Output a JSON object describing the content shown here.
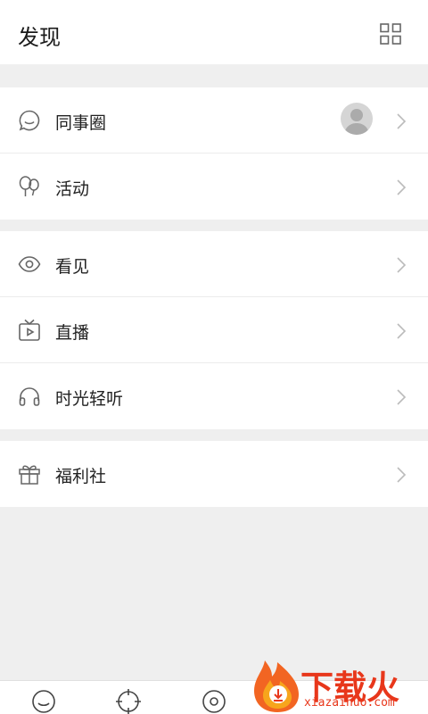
{
  "header": {
    "title": "发现",
    "menu_icon": "grid-icon"
  },
  "groups": [
    {
      "items": [
        {
          "label": "同事圈",
          "icon": "chat-bubble-icon",
          "has_avatar": true
        },
        {
          "label": "活动",
          "icon": "balloon-icon"
        }
      ]
    },
    {
      "items": [
        {
          "label": "看见",
          "icon": "eye-icon"
        },
        {
          "label": "直播",
          "icon": "tv-play-icon"
        },
        {
          "label": "时光轻听",
          "icon": "headphones-icon"
        }
      ]
    },
    {
      "items": [
        {
          "label": "福利社",
          "icon": "gift-icon"
        }
      ]
    }
  ],
  "bottom_tabs": [
    "chat-circle-icon",
    "crosshair-icon",
    "disc-icon"
  ],
  "watermark": {
    "text": "下载火",
    "url": "xiazaihuo.com"
  },
  "colors": {
    "background": "#efefef",
    "icon": "#666666",
    "chevron": "#bbbbbb",
    "watermark": "#e8371b"
  }
}
